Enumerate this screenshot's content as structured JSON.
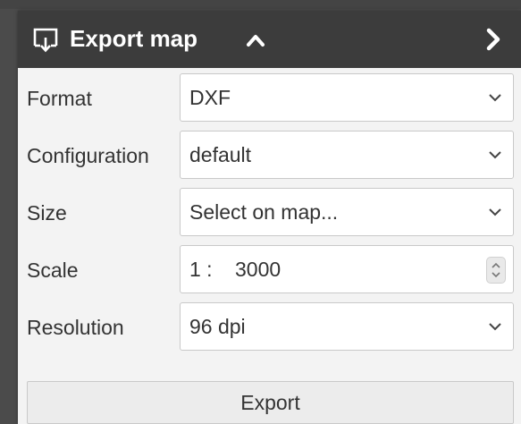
{
  "panel": {
    "title": "Export map",
    "icons": {
      "title": "export-map-icon",
      "collapse": "chevron-up-icon",
      "next": "chevron-right-icon"
    }
  },
  "form": {
    "format": {
      "label": "Format",
      "value": "DXF"
    },
    "configuration": {
      "label": "Configuration",
      "value": "default"
    },
    "size": {
      "label": "Size",
      "value": "Select on map..."
    },
    "scale": {
      "label": "Scale",
      "prefix": "1 :",
      "value": "3000"
    },
    "resolution": {
      "label": "Resolution",
      "value": "96 dpi"
    }
  },
  "actions": {
    "export_label": "Export"
  },
  "colors": {
    "titlebar": "#3c3c3c",
    "form_background": "#f3f3f3",
    "field_border": "#c9c9c9",
    "text": "#333333"
  }
}
